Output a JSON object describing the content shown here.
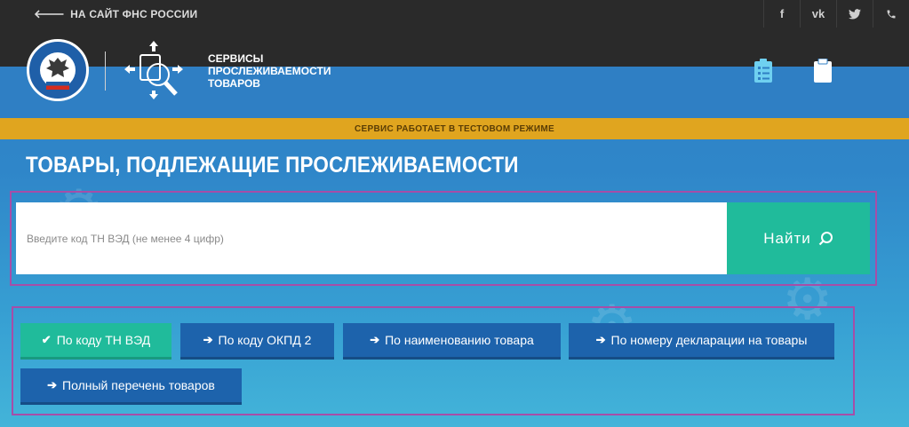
{
  "topbar": {
    "back_label": "НА САЙТ ФНС РОССИИ",
    "social": [
      {
        "icon": "facebook-icon",
        "glyph": "f"
      },
      {
        "icon": "vk-icon",
        "glyph": "vk"
      },
      {
        "icon": "twitter-icon",
        "glyph": "🐦"
      },
      {
        "icon": "phone-icon",
        "glyph": "☎"
      }
    ]
  },
  "header": {
    "brand_lines": [
      "СЕРВИСЫ",
      "ПРОСЛЕЖИВАЕМОСТИ",
      "ТОВАРОВ"
    ],
    "icons": [
      "checklist-icon",
      "clipboard-icon"
    ]
  },
  "banner": {
    "text": "СЕРВИС РАБОТАЕТ В ТЕСТОВОМ РЕЖИМЕ"
  },
  "main": {
    "title": "ТОВАРЫ, ПОДЛЕЖАЩИЕ ПРОСЛЕЖИВАЕМОСТИ",
    "search": {
      "placeholder": "Введите код ТН ВЭД (не менее 4 цифр)",
      "value": "",
      "button_label": "Найти"
    },
    "tabs": [
      {
        "label": "По коду ТН ВЭД",
        "icon": "check-icon",
        "active": true
      },
      {
        "label": "По коду ОКПД 2",
        "icon": "arrow-right-icon",
        "active": false
      },
      {
        "label": "По наименованию товара",
        "icon": "arrow-right-icon",
        "active": false
      },
      {
        "label": "По номеру декларации на товары",
        "icon": "arrow-right-icon",
        "active": false
      },
      {
        "label": "Полный перечень товаров",
        "icon": "arrow-right-icon",
        "active": false
      }
    ]
  },
  "colors": {
    "accent": "#20bb9b",
    "tab_blue": "#1d63ac",
    "banner": "#e0a51f",
    "topbar": "#2a2a2a",
    "frame": "#a64ea8"
  }
}
